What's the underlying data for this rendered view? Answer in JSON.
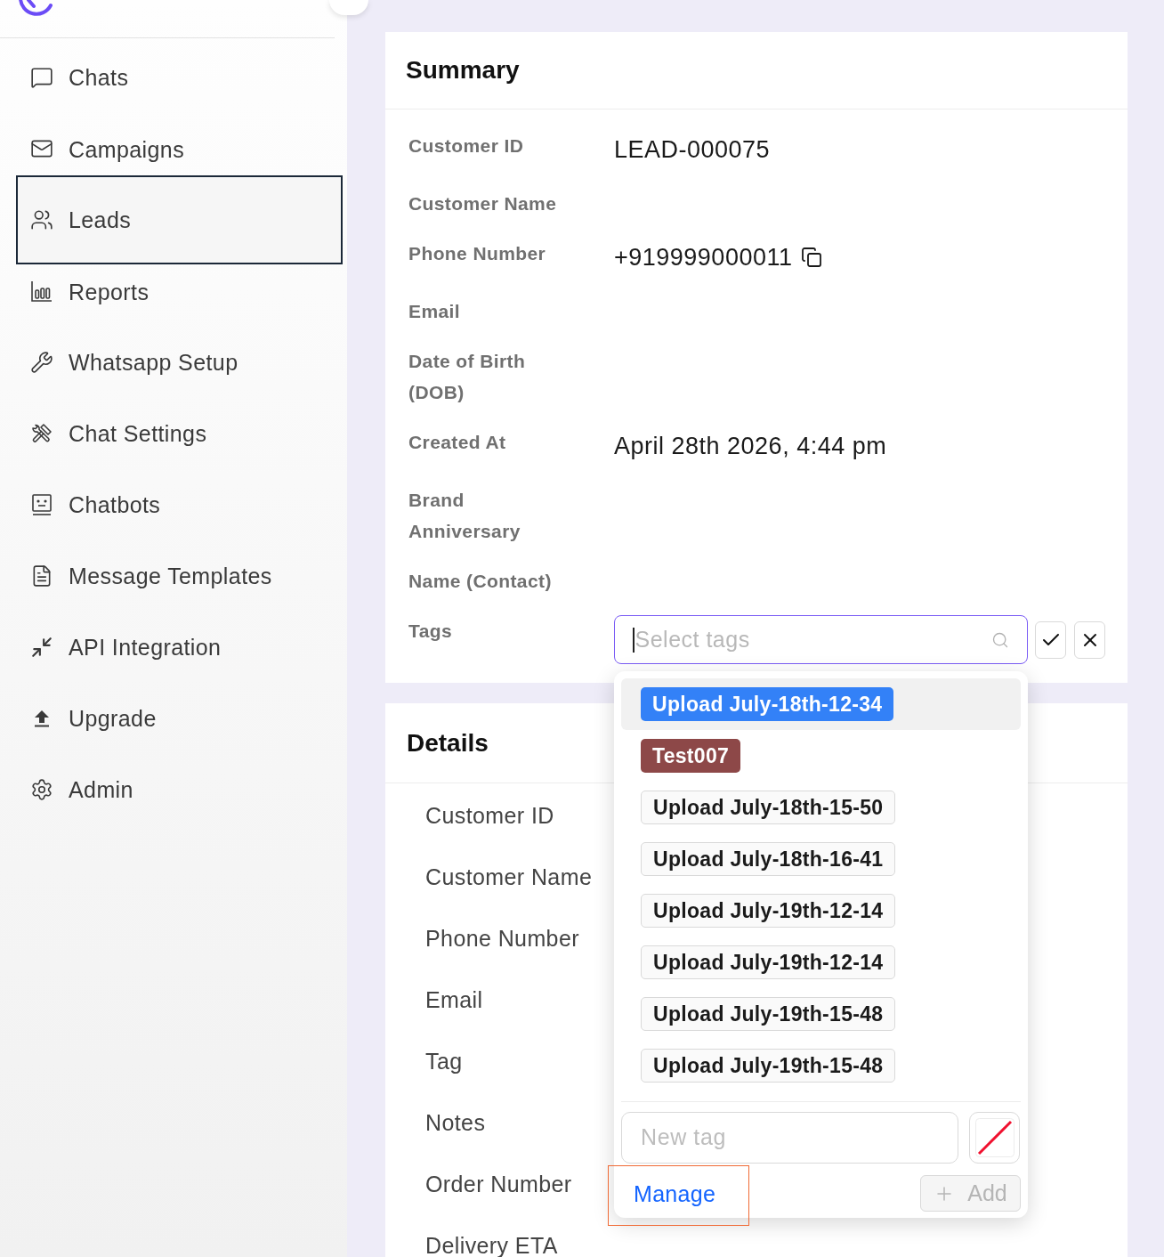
{
  "sidebar": {
    "items": [
      {
        "label": "Chats",
        "selected": false
      },
      {
        "label": "Campaigns",
        "selected": false
      },
      {
        "label": "Leads",
        "selected": true
      },
      {
        "label": "Reports",
        "selected": false
      },
      {
        "label": "Whatsapp Setup",
        "selected": false
      },
      {
        "label": "Chat Settings",
        "selected": false
      },
      {
        "label": "Chatbots",
        "selected": false
      },
      {
        "label": "Message Templates",
        "selected": false
      },
      {
        "label": "API Integration",
        "selected": false
      },
      {
        "label": "Upgrade",
        "selected": false
      },
      {
        "label": "Admin",
        "selected": false
      }
    ]
  },
  "summary": {
    "title": "Summary",
    "rows": [
      {
        "label": "Customer ID",
        "value": "LEAD-000075"
      },
      {
        "label": "Customer Name"
      },
      {
        "label": "Phone Number",
        "value": "+919999000011",
        "copyable": true
      },
      {
        "label": "Email"
      },
      {
        "label": "Date of Birth (DOB)"
      },
      {
        "label": "Created At",
        "value": "April 28th 2026, 4:44 pm"
      },
      {
        "label": "Brand Anniversary"
      },
      {
        "label": "Name (Contact)"
      }
    ],
    "tags": {
      "label": "Tags",
      "placeholder": "Select tags",
      "focused": true,
      "dropdown": {
        "options": [
          {
            "label": "Upload July-18th-12-34",
            "color": "#3381f7",
            "selected": true
          },
          {
            "label": "Test007",
            "color": "#8d4848",
            "selected": false
          },
          {
            "label": "Upload July-18th-15-50",
            "selected": false
          },
          {
            "label": "Upload July-18th-16-41",
            "selected": false
          },
          {
            "label": "Upload July-19th-12-14",
            "selected": false
          },
          {
            "label": "Upload July-19th-12-14",
            "selected": false
          },
          {
            "label": "Upload July-19th-15-48",
            "selected": false
          },
          {
            "label": "Upload July-19th-15-48",
            "selected": false
          }
        ],
        "new_tag": {
          "placeholder": "New tag"
        },
        "manage_link": {
          "label": "Manage",
          "highlighted": true
        },
        "add_button": {
          "label": "Add",
          "disabled": true
        }
      }
    }
  },
  "details": {
    "title": "Details",
    "labels": [
      "Customer ID",
      "Customer Name",
      "Phone Number",
      "Email",
      "Tag",
      "Notes",
      "Order Number",
      "Delivery ETA"
    ]
  }
}
